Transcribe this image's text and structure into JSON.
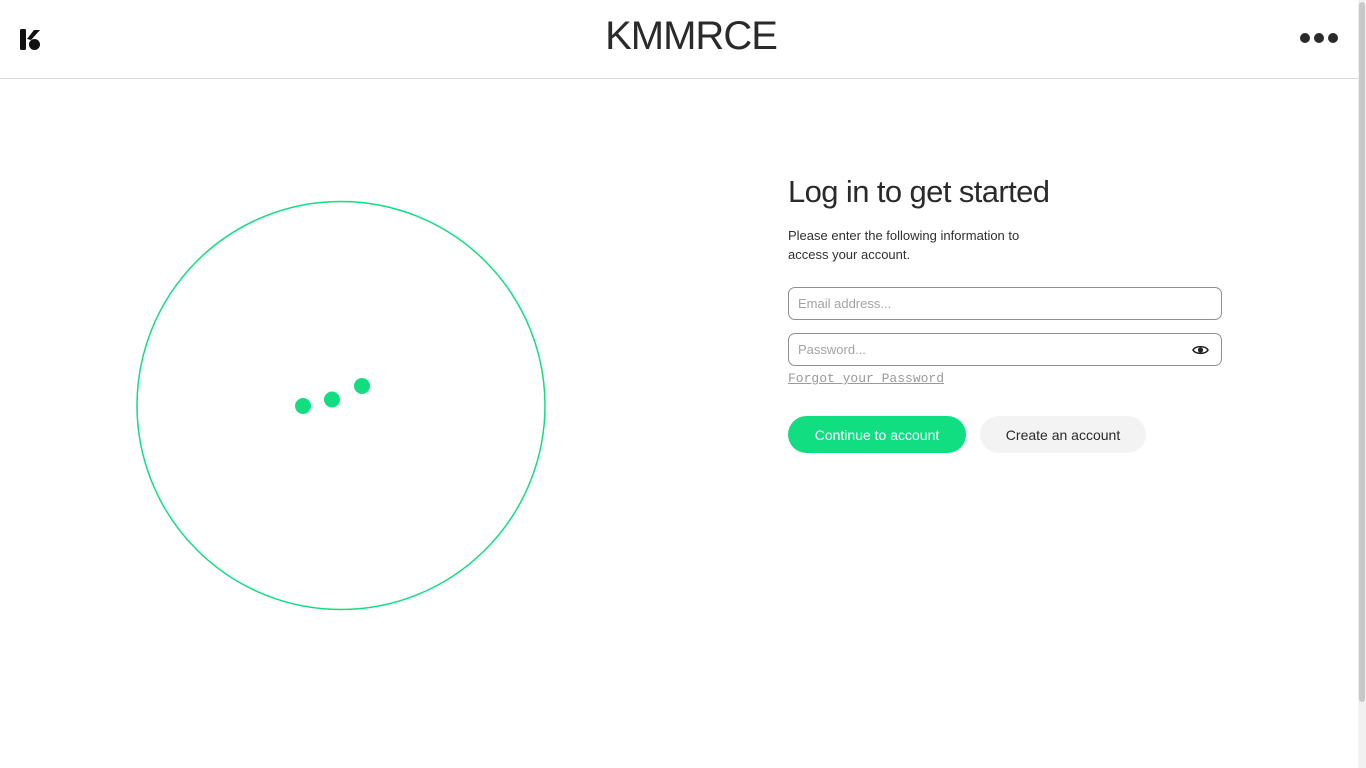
{
  "header": {
    "brand": "KMMRCE",
    "logo_icon": "k-logo-icon",
    "menu_icon": "more-dots-icon"
  },
  "loader": {
    "icon": "loading-dots-icon",
    "accent_color": "#10de81"
  },
  "login": {
    "title": "Log in to get started",
    "subtitle": "Please enter the following information to access your account.",
    "email_placeholder": "Email address...",
    "email_value": "",
    "password_placeholder": "Password...",
    "password_value": "",
    "show_password_icon": "eye-icon",
    "forgot_label": "Forgot your Password",
    "continue_label": "Continue to account",
    "create_label": "Create an account"
  },
  "colors": {
    "accent": "#10de81",
    "secondary_button": "#f3f3f3",
    "text": "#2a2a2a"
  }
}
